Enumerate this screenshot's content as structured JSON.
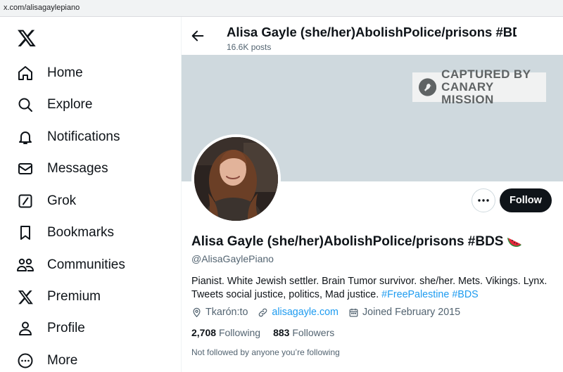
{
  "browser": {
    "url": "x.com/alisagaylepiano"
  },
  "sidebar": {
    "logo_icon": "x-logo-icon",
    "items": [
      {
        "label": "Home",
        "icon": "home-icon"
      },
      {
        "label": "Explore",
        "icon": "search-icon"
      },
      {
        "label": "Notifications",
        "icon": "bell-icon"
      },
      {
        "label": "Messages",
        "icon": "envelope-icon"
      },
      {
        "label": "Grok",
        "icon": "grok-icon"
      },
      {
        "label": "Bookmarks",
        "icon": "bookmark-icon"
      },
      {
        "label": "Communities",
        "icon": "people-icon"
      },
      {
        "label": "Premium",
        "icon": "x-logo-icon"
      },
      {
        "label": "Profile",
        "icon": "person-icon"
      },
      {
        "label": "More",
        "icon": "more-circle-icon"
      }
    ]
  },
  "header": {
    "title": "Alisa Gayle (she/her)AbolishPolice/prisons #BDS",
    "posts": "16.6K posts"
  },
  "banner": {
    "stamp_line1": "CAPTURED BY",
    "stamp_line2": "CANARY MISSION",
    "color": "#cfd9de"
  },
  "profile": {
    "name": "Alisa Gayle (she/her)AbolishPolice/prisons #BDS",
    "name_emoji": "watermelon",
    "handle": "@AlisaGaylePiano",
    "bio_text": "Pianist. White Jewish settler. Brain Tumor survivor. she/her. Mets. Vikings. Lynx. Tweets social justice, politics, Mad justice.",
    "bio_tags": [
      "#FreePalestine",
      "#BDS"
    ],
    "location": "Tkarón:to",
    "website": "alisagayle.com",
    "joined": "Joined February 2015",
    "following_count": "2,708",
    "following_label": "Following",
    "followers_count": "883",
    "followers_label": "Followers",
    "not_followed": "Not followed by anyone you’re following",
    "follow_button": "Follow",
    "more_button": "more-dots-icon"
  },
  "colors": {
    "link": "#1d9bf0",
    "muted": "#536471",
    "text": "#0f1419"
  }
}
